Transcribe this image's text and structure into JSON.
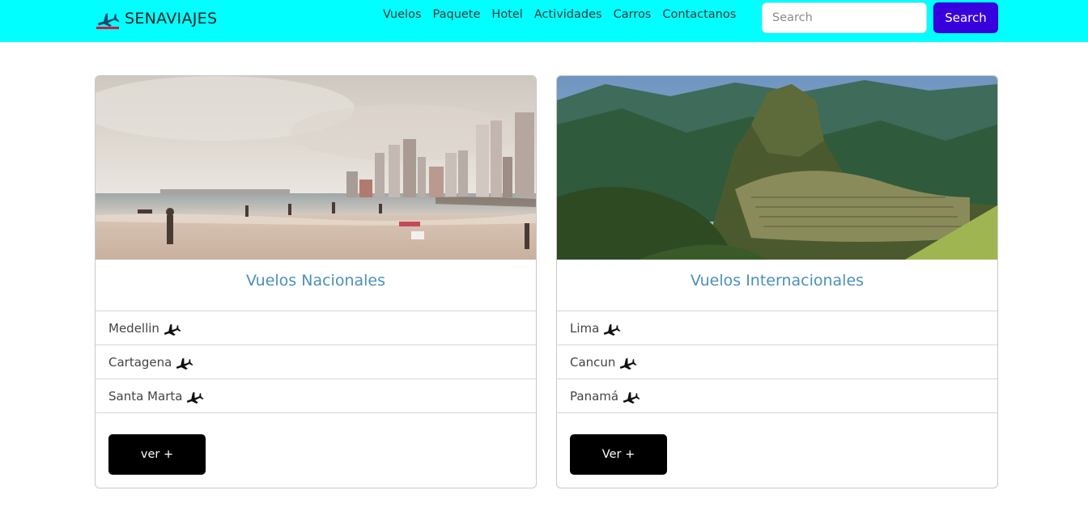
{
  "navbar": {
    "brand": "SENAVIAJES",
    "brand_icon": "airplane-icon",
    "accent_color": "#00ffff",
    "links": [
      "Vuelos",
      "Paquete",
      "Hotel",
      "Actividades",
      "Carros",
      "Contactanos"
    ],
    "search_placeholder": "Search",
    "search_button": "Search",
    "search_button_color": "#3700dd"
  },
  "cards": [
    {
      "image": "beach-city-skyline-image",
      "title": "Vuelos Nacionales",
      "destinations": [
        "Medellin",
        "Cartagena",
        "Santa Marta"
      ],
      "destination_icon": "airplane-icon",
      "button": "ver +"
    },
    {
      "image": "machu-picchu-mountains-image",
      "title": "Vuelos Internacionales",
      "destinations": [
        "Lima",
        "Cancun",
        "Panamá"
      ],
      "destination_icon": "airplane-icon",
      "button": "Ver +"
    }
  ]
}
